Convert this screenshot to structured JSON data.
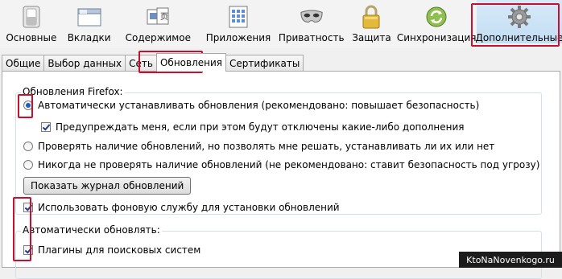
{
  "toolbar": {
    "items": [
      {
        "label": "Основные",
        "icon": "switch-icon"
      },
      {
        "label": "Вкладки",
        "icon": "tabs-window-icon"
      },
      {
        "label": "Содержимое",
        "icon": "content-icon"
      },
      {
        "label": "Приложения",
        "icon": "applications-icon"
      },
      {
        "label": "Приватность",
        "icon": "mask-icon"
      },
      {
        "label": "Защита",
        "icon": "padlock-icon"
      },
      {
        "label": "Синхронизация",
        "icon": "sync-icon"
      },
      {
        "label": "Дополнительные",
        "icon": "gear-icon"
      }
    ],
    "active_index": 7
  },
  "tabs": {
    "items": [
      "Общие",
      "Выбор данных",
      "Сеть",
      "Обновления",
      "Сертификаты"
    ],
    "active_index": 3
  },
  "updates": {
    "group_title": "Обновления Firefox:",
    "auto_install": "Автоматически устанавливать обновления (рекомендовано: повышает безопасность)",
    "warn_addons": "Предупреждать меня, если при этом будут отключены какие-либо дополнения",
    "check_ask": "Проверять наличие обновлений, но позволять мне решать, устанавливать ли их или нет",
    "never_check": "Никогда не проверять наличие обновлений (не рекомендовано: ставит безопасность под угрозу)",
    "log_button": "Показать журнал обновлений",
    "background_service": "Использовать фоновую службу для установки обновлений"
  },
  "auto_update": {
    "group_title": "Автоматически обновлять:",
    "search_plugins": "Плагины для поисковых систем"
  },
  "watermark": "KtoNaNovenkogo.ru",
  "colors": {
    "highlight_red": "#c8102e",
    "active_toolbar_bg": "#c3ddf3"
  }
}
